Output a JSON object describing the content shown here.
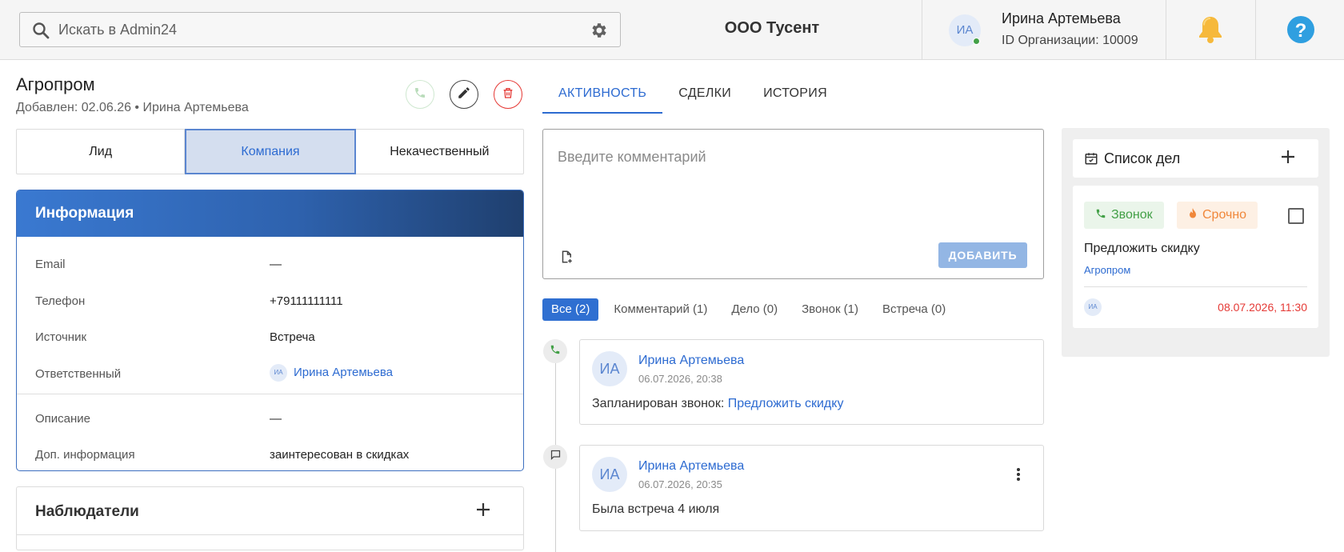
{
  "header": {
    "search_placeholder": "Искать в Admin24",
    "org_name": "ООО Тусент",
    "user_initials": "ИА",
    "user_name": "Ирина Артемьева",
    "org_id": "ID Организации: 10009"
  },
  "company": {
    "name": "Агропром",
    "added": "Добавлен: 02.06.26 • Ирина Артемьева"
  },
  "status_tabs": [
    "Лид",
    "Компания",
    "Некачественный"
  ],
  "status_active": "Компания",
  "info": {
    "title": "Информация",
    "rows": [
      {
        "label": "Email",
        "value": "—"
      },
      {
        "label": "Телефон",
        "value": "+79111111111"
      },
      {
        "label": "Источник",
        "value": "Встреча"
      },
      {
        "label": "Ответственный",
        "value": "Ирина Артемьева",
        "initials": "ИА"
      },
      {
        "label": "Описание",
        "value": "—"
      },
      {
        "label": "Доп. информация",
        "value": "заинтересован в скидках"
      }
    ]
  },
  "observers": {
    "title": "Наблюдатели"
  },
  "activity_tabs": [
    "АКТИВНОСТЬ",
    "СДЕЛКИ",
    "ИСТОРИЯ"
  ],
  "comment": {
    "placeholder": "Введите комментарий",
    "add_label": "ДОБАВИТЬ"
  },
  "filters": [
    "Все (2)",
    "Комментарий (1)",
    "Дело (0)",
    "Звонок (1)",
    "Встреча (0)"
  ],
  "events": [
    {
      "initials": "ИА",
      "author": "Ирина Артемьева",
      "date": "06.07.2026, 20:38",
      "text": "Запланирован звонок: ",
      "link": "Предложить скидку"
    },
    {
      "initials": "ИА",
      "author": "Ирина Артемьева",
      "date": "06.07.2026, 20:35",
      "text": "Была встреча 4 июля"
    }
  ],
  "todo": {
    "title": "Список дел",
    "tag_call": "Звонок",
    "tag_urgent": "Срочно",
    "task": "Предложить скидку",
    "company": "Агропром",
    "initials": "ИА",
    "due": "08.07.2026, 11:30"
  },
  "colors": {
    "accent": "#2d6bd1",
    "danger": "#e53935",
    "success": "#43a047",
    "warning": "#f0873a"
  }
}
